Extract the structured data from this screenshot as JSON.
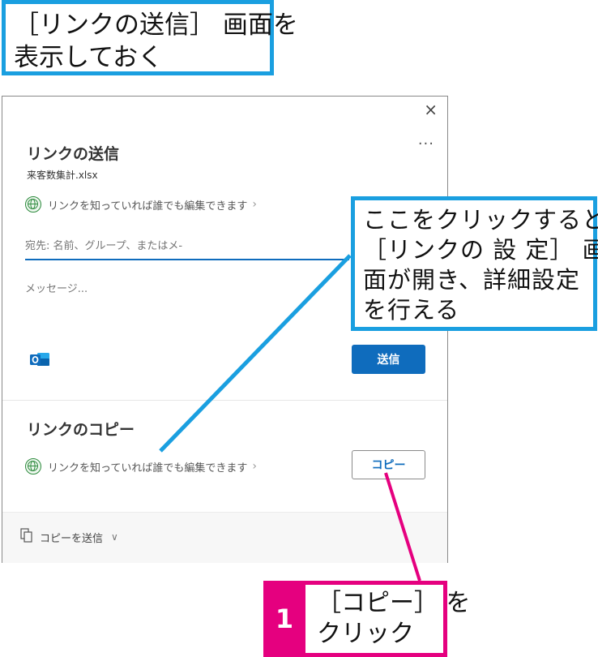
{
  "callout_top": {
    "line1": "［リンクの送信］ 画面を",
    "line2": "表示しておく"
  },
  "callout_right": {
    "line1": "ここをクリックすると",
    "line2": "［リンクの 設 定］ 画",
    "line3": "面が開き、詳細設定",
    "line4": "を行える"
  },
  "step": {
    "number": "1",
    "line1": "［コピー］ を",
    "line2": "クリック"
  },
  "dialog": {
    "close_icon": "×",
    "more_icon": "···",
    "send_title": "リンクの送信",
    "file_name": "来客数集計.xlsx",
    "permission_send": "リンクを知っていれば誰でも編集できます",
    "permission_chevron": "›",
    "to_placeholder": "宛先: 名前、グループ、またはメ-",
    "message_placeholder": "メッセージ...",
    "send_button": "送信",
    "copy_title": "リンクのコピー",
    "permission_copy": "リンクを知っていれば誰でも編集できます",
    "copy_button": "コピー",
    "send_copy": "コピーを送信",
    "send_copy_chevron": "∨"
  },
  "colors": {
    "callout_border": "#1a9fe0",
    "step_magenta": "#e5007f",
    "primary_button": "#0f6cbd",
    "globe_green": "#2e8b3e"
  },
  "icons": [
    "close-icon",
    "more-icon",
    "globe-icon",
    "outlook-icon",
    "copy-doc-icon",
    "chevron-down-icon"
  ]
}
